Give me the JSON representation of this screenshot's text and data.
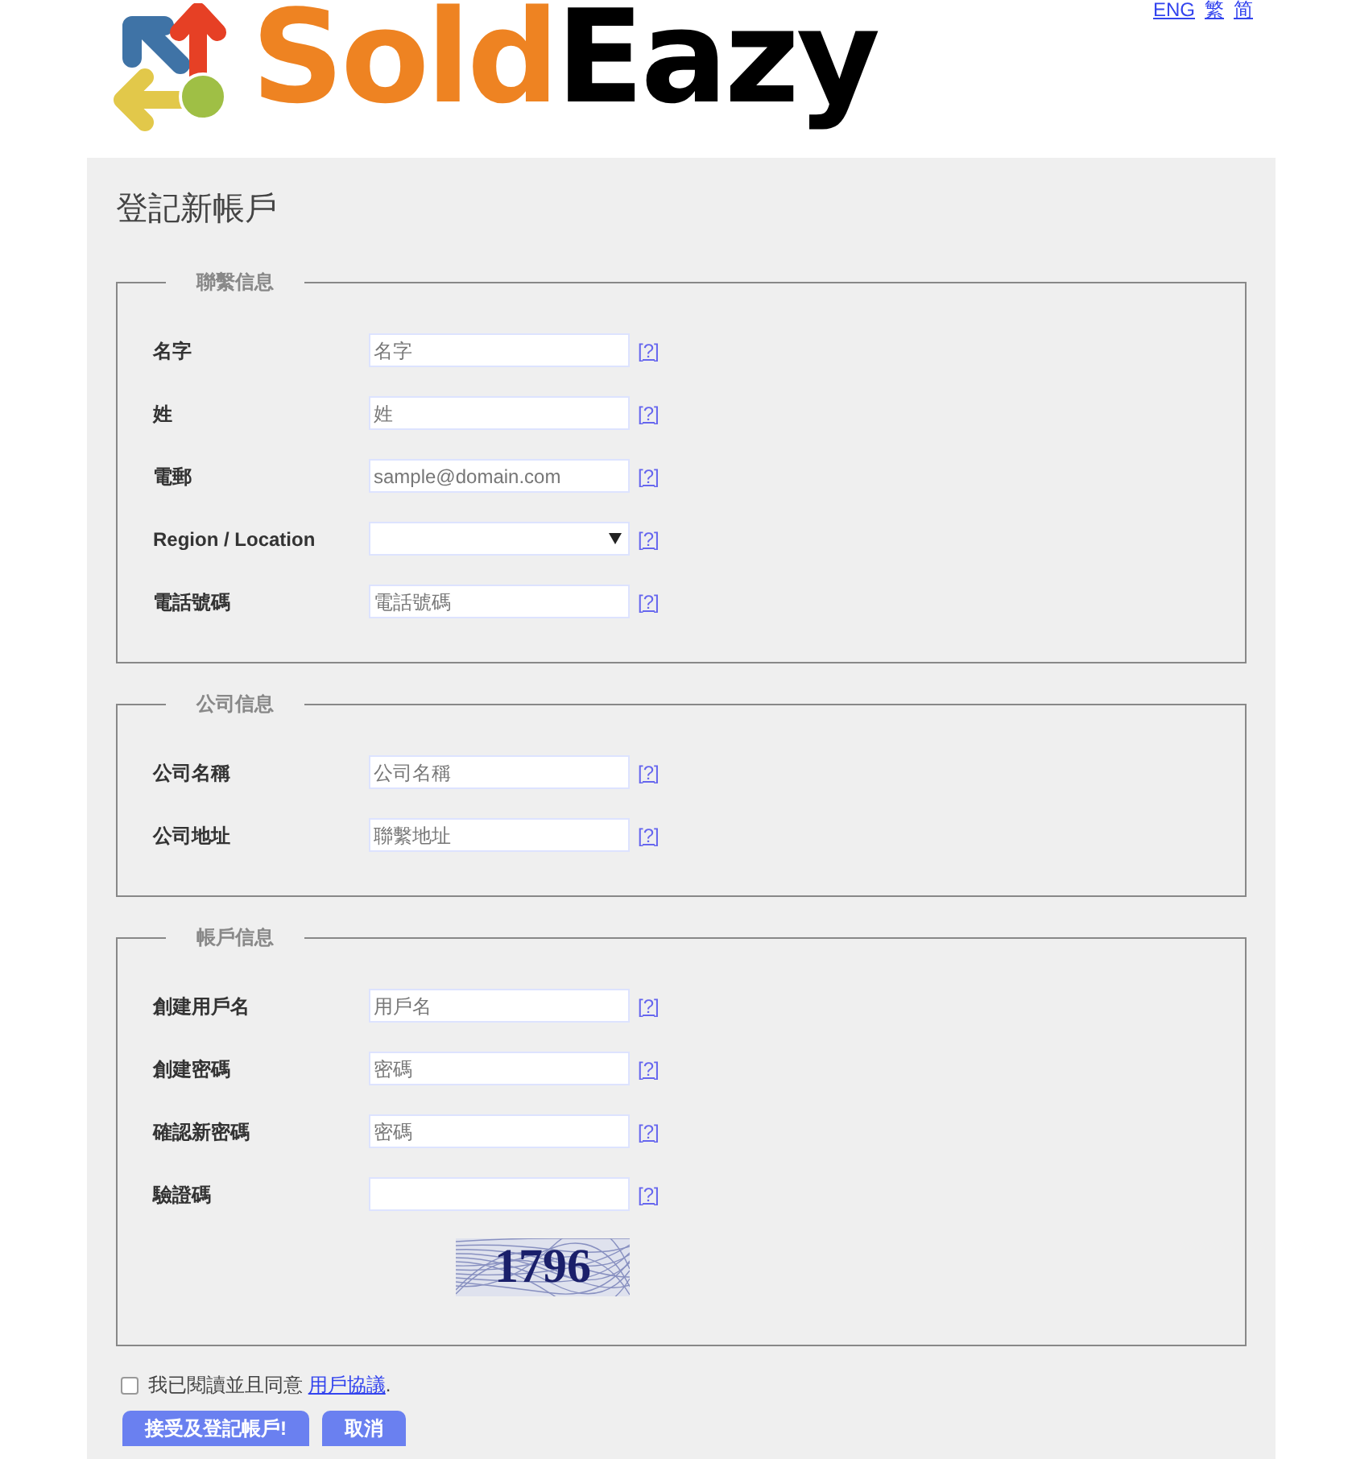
{
  "logo": {
    "part_1": "Sold",
    "part_2": "Eazy"
  },
  "languages": [
    {
      "label": "ENG"
    },
    {
      "label": "繁"
    },
    {
      "label": "简"
    }
  ],
  "title": "登記新帳戶",
  "sections": [
    {
      "legend": "聯繫信息",
      "fields": [
        {
          "kind": "text",
          "label": "名字",
          "placeholder": "名字",
          "help": "[?]"
        },
        {
          "kind": "text",
          "label": "姓",
          "placeholder": "姓",
          "help": "[?]"
        },
        {
          "kind": "text",
          "label": "電郵",
          "placeholder": "sample@domain.com",
          "help": "[?]"
        },
        {
          "kind": "select",
          "label": "Region / Location",
          "help": "[?]"
        },
        {
          "kind": "text",
          "label": "電話號碼",
          "placeholder": "電話號碼",
          "help": "[?]"
        }
      ]
    },
    {
      "legend": "公司信息",
      "fields": [
        {
          "kind": "text",
          "label": "公司名稱",
          "placeholder": "公司名稱",
          "help": "[?]"
        },
        {
          "kind": "text",
          "label": "公司地址",
          "placeholder": "聯繫地址",
          "help": "[?]"
        }
      ]
    },
    {
      "legend": "帳戶信息",
      "fields": [
        {
          "kind": "text",
          "label": "創建用戶名",
          "placeholder": "用戶名",
          "help": "[?]"
        },
        {
          "kind": "password",
          "label": "創建密碼",
          "placeholder": "密碼",
          "help": "[?]"
        },
        {
          "kind": "password",
          "label": "確認新密碼",
          "placeholder": "密碼",
          "help": "[?]"
        },
        {
          "kind": "text",
          "label": "驗證碼",
          "help": "[?]"
        }
      ],
      "captcha": "1796"
    }
  ],
  "agreement": {
    "checked": false,
    "text": "我已閱讀並且同意",
    "link": "用戶協議",
    "end": "."
  },
  "buttons": [
    {
      "label": "接受及登記帳戶!"
    },
    {
      "label": "取消"
    }
  ]
}
